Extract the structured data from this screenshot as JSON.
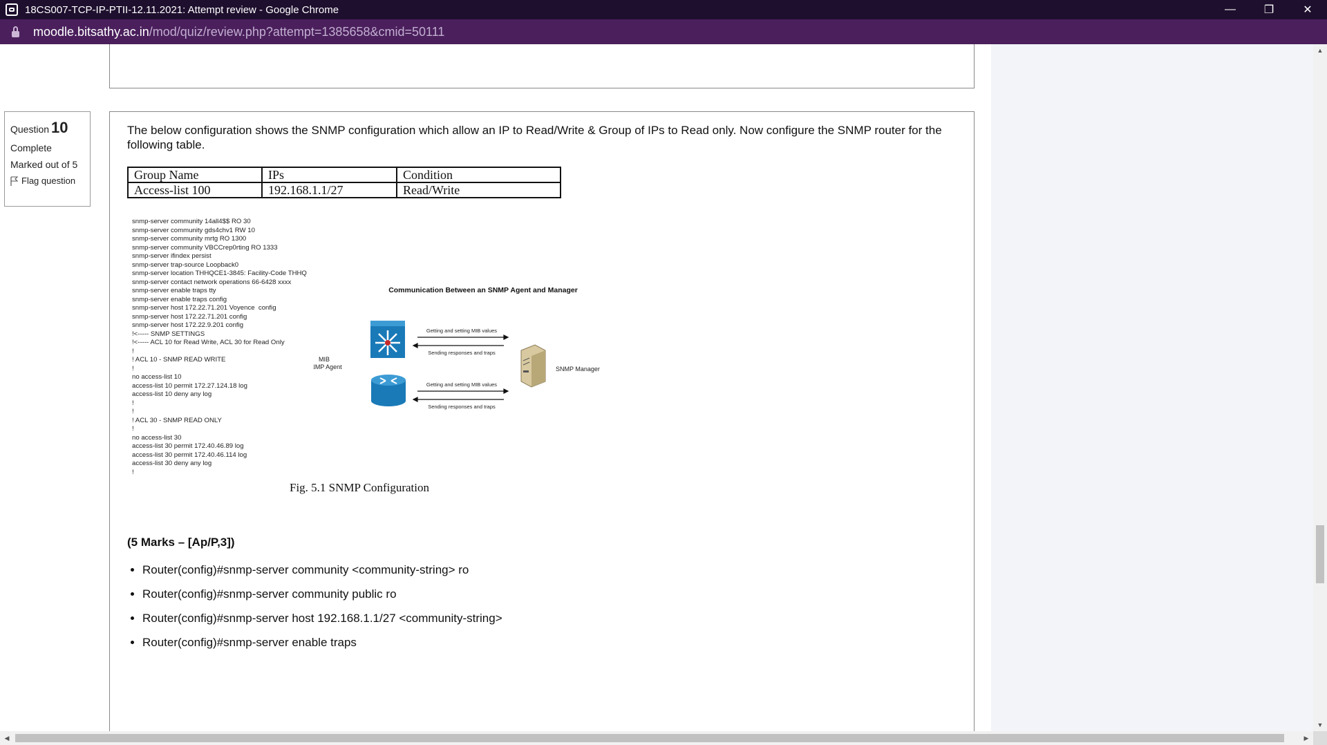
{
  "window": {
    "title": "18CS007-TCP-IP-PTII-12.11.2021: Attempt review - Google Chrome",
    "controls": {
      "minimize": "—",
      "restore": "❐",
      "close": "✕"
    }
  },
  "address": {
    "host": "moodle.bitsathy.ac.in",
    "path": "/mod/quiz/review.php?attempt=1385658&cmid=50111"
  },
  "question_info": {
    "label": "Question",
    "number": "10",
    "state": "Complete",
    "grade": "Marked out of 5",
    "flag": "Flag question"
  },
  "question": {
    "text": "The below configuration shows the SNMP configuration which allow an IP to Read/Write & Group of IPs to Read only. Now configure the SNMP router for the following table.",
    "table": {
      "headers": [
        "Group Name",
        "IPs",
        "Condition"
      ],
      "rows": [
        [
          "Access-list 100",
          "192.168.1.1/27",
          "Read/Write"
        ]
      ]
    },
    "config_lines": [
      "snmp-server community 14all4$$ RO 30",
      "snmp-server community gds4chv1 RW 10",
      "snmp-server community mrtg RO 1300",
      "snmp-server community VBCCrep0rting RO 1333",
      "snmp-server ifindex persist",
      "snmp-server trap-source Loopback0",
      "snmp-server location THHQCE1-3845: Facility-Code THHQ",
      "snmp-server contact network operations 66-6428 xxxx",
      "snmp-server enable traps tty",
      "snmp-server enable traps config",
      "snmp-server host 172.22.71.201 Voyence  config",
      "snmp-server host 172.22.71.201 config",
      "snmp-server host 172.22.9.201 config",
      "!<----- SNMP SETTINGS",
      "!<----- ACL 10 for Read Write, ACL 30 for Read Only",
      "!",
      "! ACL 10 - SNMP READ WRITE",
      "!",
      "no access-list 10",
      "access-list 10 permit 172.27.124.18 log",
      "access-list 10 deny any log",
      "!",
      "!",
      "! ACL 30 - SNMP READ ONLY",
      "!",
      "no access-list 30",
      "access-list 30 permit 172.40.46.89 log",
      "access-list 30 permit 172.40.46.114 log",
      "access-list 30 deny any log",
      "!"
    ],
    "diagram": {
      "title": "Communication Between an SNMP Agent and Manager",
      "agent_label_1": "MIB",
      "agent_label_2": "SNMP Agent",
      "manager_label": "SNMP Manager",
      "arrow_get_1": "Getting and setting MIB values",
      "arrow_resp_1": "Sending responses and traps",
      "arrow_get_2": "Getting and setting MIB values",
      "arrow_resp_2": "Sending responses and traps"
    },
    "figure_caption": "Fig. 5.1 SNMP  Configuration",
    "marks": "(5 Marks – [Ap/P,3])",
    "answers": [
      "Router(config)#snmp-server community <community-string> ro",
      "Router(config)#snmp-server community public ro",
      "Router(config)#snmp-server host 192.168.1.1/27 <community-string>",
      "Router(config)#snmp-server enable traps"
    ]
  },
  "colors": {
    "titlebar": "#1e0f2e",
    "addressbar": "#4a1f5c",
    "right_pane": "#f2f4f9"
  }
}
